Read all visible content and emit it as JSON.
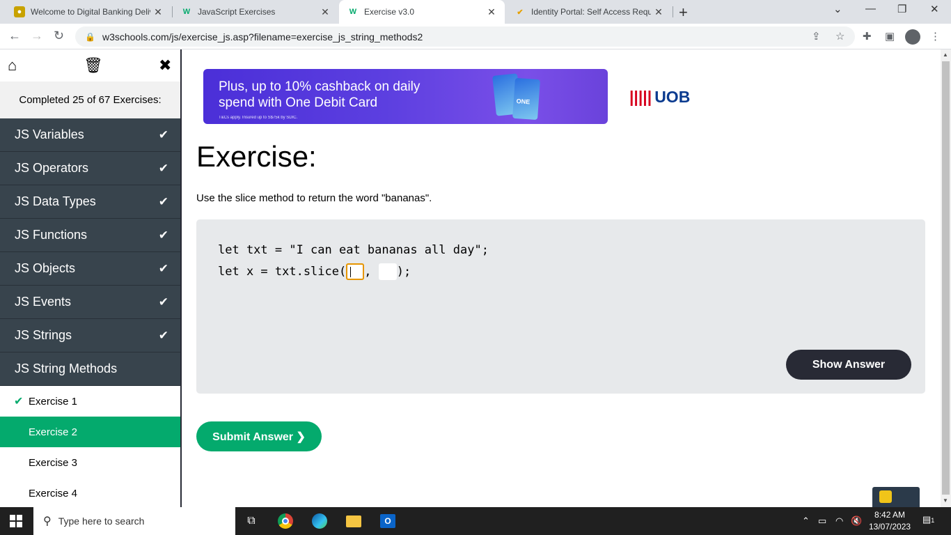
{
  "browser": {
    "tabs": [
      {
        "title": "Welcome to Digital Banking Deliv",
        "icon": "bank-favicon-icon"
      },
      {
        "title": "JavaScript Exercises",
        "icon": "w3schools-favicon-icon"
      },
      {
        "title": "Exercise v3.0",
        "icon": "w3schools-favicon-icon",
        "active": true
      },
      {
        "title": "Identity Portal: Self Access Reque",
        "icon": "identity-favicon-icon"
      }
    ],
    "new_tab": "+",
    "url": "w3schools.com/js/exercise_js.asp?filename=exercise_js_string_methods2"
  },
  "sidebar": {
    "completed_text": "Completed 25 of 67 Exercises:",
    "categories": [
      {
        "label": "JS Variables",
        "done": true
      },
      {
        "label": "JS Operators",
        "done": true
      },
      {
        "label": "JS Data Types",
        "done": true
      },
      {
        "label": "JS Functions",
        "done": true
      },
      {
        "label": "JS Objects",
        "done": true
      },
      {
        "label": "JS Events",
        "done": true
      },
      {
        "label": "JS Strings",
        "done": true
      },
      {
        "label": "JS String Methods",
        "done": false
      }
    ],
    "exercises": [
      {
        "label": "Exercise 1",
        "done": true
      },
      {
        "label": "Exercise 2",
        "active": true
      },
      {
        "label": "Exercise 3"
      },
      {
        "label": "Exercise 4"
      }
    ]
  },
  "ad": {
    "line1": "Plus, up to 10% cashback on daily",
    "line2": "spend with One Debit Card",
    "fine_print": "T&Cs apply. Insured up to S$75k by SDIC.",
    "brand": "UOB",
    "card_label": "ONE"
  },
  "exercise": {
    "heading": "Exercise:",
    "instruction": "Use the slice method to return the word \"bananas\".",
    "code_line1": "let txt = \"I can eat bananas all day\";",
    "code_line2_prefix": "let x = txt.slice(",
    "code_line2_sep": ", ",
    "code_line2_suffix": ");",
    "input1_value": "",
    "input2_value": "",
    "show_answer": "Show Answer",
    "submit": "Submit Answer ❯"
  },
  "taskbar": {
    "search_placeholder": "Type here to search",
    "time": "8:42 AM",
    "date": "13/07/2023",
    "notification_count": "1"
  }
}
